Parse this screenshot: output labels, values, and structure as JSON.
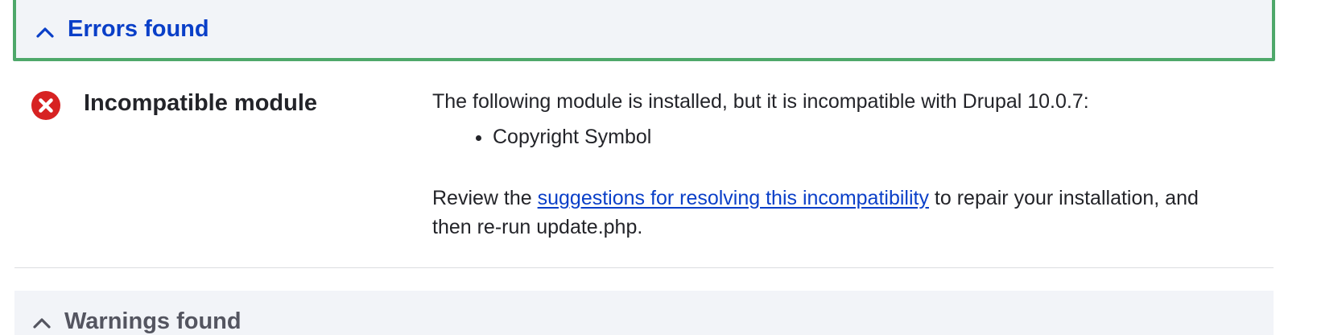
{
  "errors_section": {
    "title": "Errors found",
    "expanded": true,
    "accent_color": "#0a3fc8",
    "border_color": "#4ea86a"
  },
  "requirement": {
    "status_icon": "error-x-icon",
    "status_color": "#d72222",
    "title": "Incompatible module",
    "description": "The following module is installed, but it is incompatible with Drupal 10.0.7:",
    "modules": [
      "Copyright Symbol"
    ],
    "review_prefix": "Review the ",
    "review_link": "suggestions for resolving this incompatibility",
    "review_suffix": " to repair your installation, and then re-run update.php."
  },
  "warnings_section": {
    "title": "Warnings found",
    "expanded": true
  }
}
